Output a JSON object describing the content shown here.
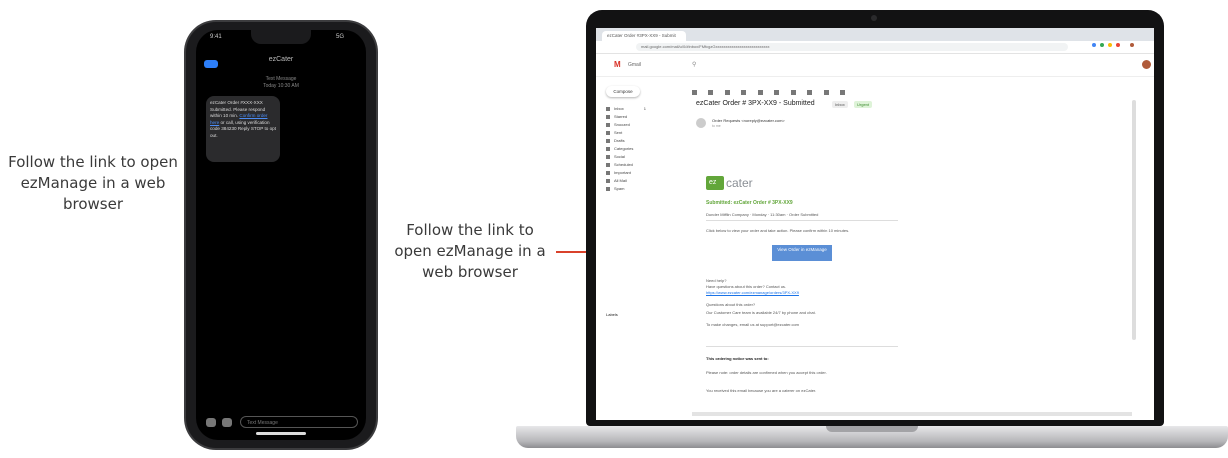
{
  "captions": {
    "left": "Follow the link to open ezManage in a web browser",
    "middle": "Follow the link to open ezManage in a web browser"
  },
  "phone": {
    "status_time": "9:41",
    "status_right": "5G",
    "header_title": "ezCater",
    "sender_line1": "Text Message",
    "sender_line2": "Today 10:30 AM",
    "message_before_link": "ezCater Order #XXX-XXX Submitted. Please respond within 10 min. ",
    "message_link": "Confirm order here",
    "message_after_link": " or call, using verification code 384230 Reply STOP to opt out.",
    "input_placeholder": "Text Message"
  },
  "laptop": {
    "tab_title": "ezCater Order #3PX-XX9 - Submit",
    "url": "mail.google.com/mail/u/0/#inbox/FMfcgzGxxxxxxxxxxxxxxxxxxxxxxxxxxx",
    "gmail": {
      "brand": "Gmail",
      "compose_label": "Compose",
      "nav": [
        {
          "label": "Inbox",
          "count": "1"
        },
        {
          "label": "Starred",
          "count": ""
        },
        {
          "label": "Snoozed",
          "count": ""
        },
        {
          "label": "Sent",
          "count": ""
        },
        {
          "label": "Drafts",
          "count": ""
        },
        {
          "label": "Categories",
          "count": ""
        },
        {
          "label": "Social",
          "count": ""
        },
        {
          "label": "Scheduled",
          "count": ""
        },
        {
          "label": "Important",
          "count": ""
        },
        {
          "label": "All Mail",
          "count": ""
        },
        {
          "label": "Spam",
          "count": ""
        }
      ],
      "labels_heading": "Labels",
      "email": {
        "subject": "ezCater Order # 3PX-XX9 - Submitted",
        "badge1": "Inbox",
        "badge2": "Urgent",
        "sender_name": "Order Requests <noreply@ezcater.com>",
        "sender_to": "to me",
        "logo_box": "ez",
        "logo_text": "cater",
        "headline": "Submitted: ezCater Order # 3PX-XX9",
        "details": "Dunder Mifflin Company · Monday · 11:30am · Order Submitted",
        "intro": "Click below to view your order and take action. Please confirm within 10 minutes.",
        "button_label": "View Order in ezManage",
        "help_heading": "Need help?",
        "help_line1": "Have questions about this order? Contact us.",
        "help_link": "https://www.ezcater.com/ezmanage/orders/3PX-XX9",
        "q_line": "Questions about this order?",
        "contact_line": "Our Customer Care team is available 24/7 by phone and chat.",
        "email_line": "To make changes, email us at support@ezcater.com",
        "section_heading": "This ordering notice was sent to:",
        "footer1": "Please note: order details are confirmed when you accept this order.",
        "footer2": "You received this email because you are a caterer on ezCater."
      }
    }
  },
  "colors": {
    "arrow": "#d9412b",
    "ezcater_green": "#62a63a",
    "gmail_red": "#d93025",
    "link_blue": "#1a73e8"
  }
}
